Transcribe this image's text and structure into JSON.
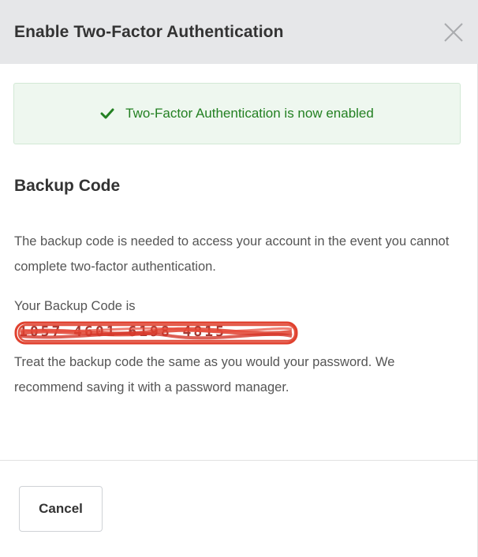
{
  "modal": {
    "title": "Enable Two-Factor Authentication",
    "close_icon": "close-icon"
  },
  "alert": {
    "icon": "checkmark-icon",
    "text": "Two-Factor Authentication is now enabled",
    "color": "#238022",
    "background": "#eef7ef"
  },
  "backup": {
    "heading": "Backup Code",
    "description": "The backup code is needed to access your account in the event you cannot complete two-factor authentication.",
    "code_label": "Your Backup Code is",
    "code_value": "1057 4601 6198 4815",
    "note": "Treat the backup code the same as you would your password. We recommend saving it with a password manager."
  },
  "footer": {
    "cancel_label": "Cancel"
  },
  "colors": {
    "header_bg": "#e6e7e9",
    "redaction": "#e0412f"
  }
}
